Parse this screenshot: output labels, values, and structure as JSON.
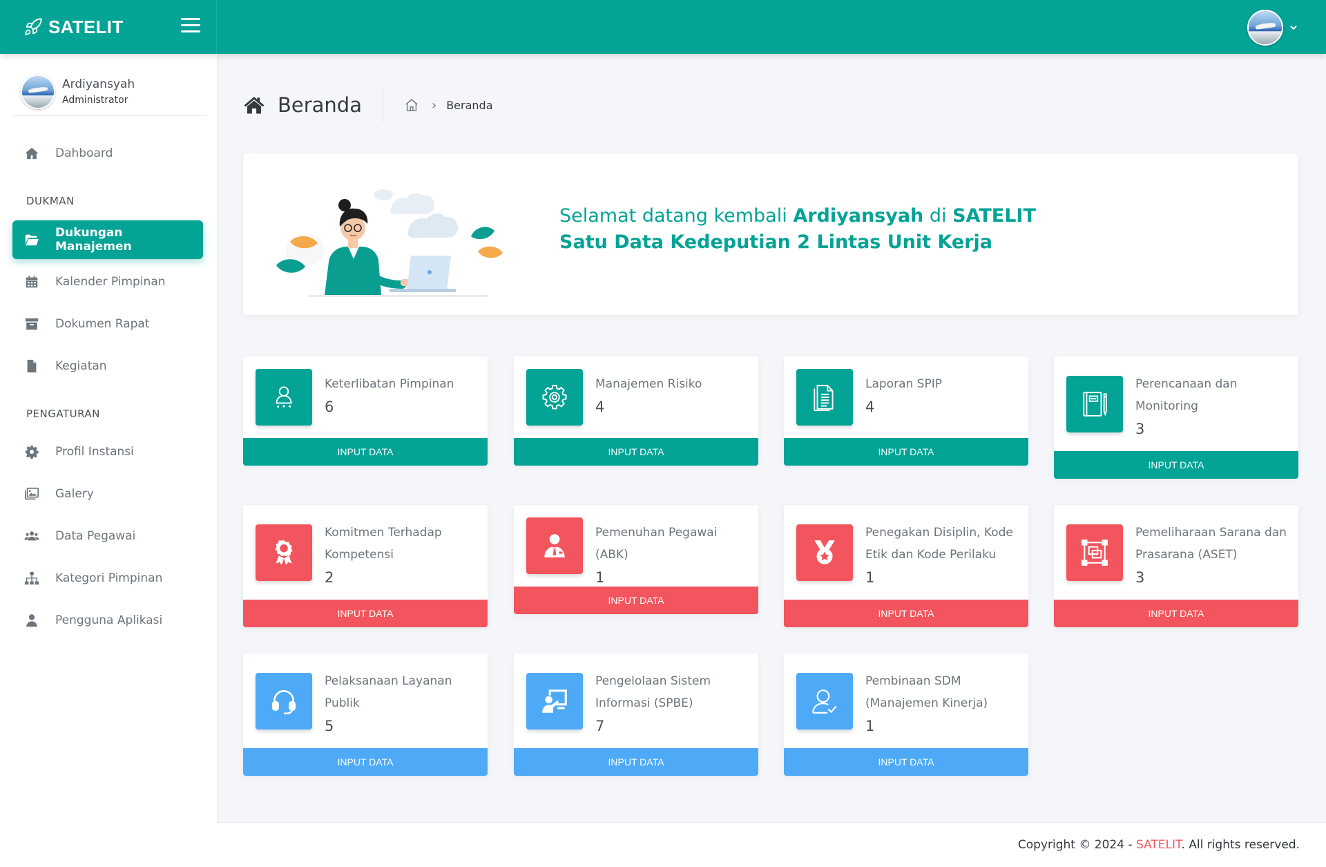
{
  "app": {
    "brand": "SATELIT"
  },
  "user": {
    "name": "Ardiyansyah",
    "role": "Administrator"
  },
  "sidebar": {
    "dashboard": "Dahboard",
    "section_dukman": "DUKMAN",
    "section_pengaturan": "PENGATURAN",
    "items": [
      {
        "label": "Dukungan Manajemen",
        "icon": "folder-open-icon",
        "active": true
      },
      {
        "label": "Kalender Pimpinan",
        "icon": "calendar-icon"
      },
      {
        "label": "Dokumen Rapat",
        "icon": "archive-icon"
      },
      {
        "label": "Kegiatan",
        "icon": "file-icon"
      },
      {
        "label": "Profil Instansi",
        "icon": "gear-icon"
      },
      {
        "label": "Galery",
        "icon": "images-icon"
      },
      {
        "label": "Data Pegawai",
        "icon": "users-icon"
      },
      {
        "label": "Kategori Pimpinan",
        "icon": "sitemap-icon"
      },
      {
        "label": "Pengguna Aplikasi",
        "icon": "user-icon"
      }
    ]
  },
  "page": {
    "title": "Beranda",
    "breadcrumb_current": "Beranda"
  },
  "welcome": {
    "line1_prefix": "Selamat datang kembali ",
    "line1_name": "Ardiyansyah",
    "line1_mid": " di ",
    "line1_brand": "SATELIT",
    "line2": "Satu Data Kedeputian 2 Lintas Unit Kerja"
  },
  "colors": {
    "teal": "#03a396",
    "red": "#f2555d",
    "blue": "#4eaaf6"
  },
  "cards": [
    {
      "label": "Keterlibatan Pimpinan",
      "count": "6",
      "button": "INPUT DATA",
      "color": "teal",
      "icon": "leader-icon"
    },
    {
      "label": "Manajemen Risiko",
      "count": "4",
      "button": "INPUT DATA",
      "color": "teal",
      "icon": "gear-icon"
    },
    {
      "label": "Laporan SPIP",
      "count": "4",
      "button": "INPUT DATA",
      "color": "teal",
      "icon": "document-icon"
    },
    {
      "label": "Perencanaan dan Monitoring",
      "count": "3",
      "button": "INPUT DATA",
      "color": "teal",
      "icon": "notebook-icon"
    },
    {
      "label": "Komitmen Terhadap Kompetensi",
      "count": "2",
      "button": "INPUT DATA",
      "color": "red",
      "icon": "award-icon"
    },
    {
      "label": "Pemenuhan Pegawai (ABK)",
      "count": "1",
      "button": "INPUT DATA",
      "color": "red",
      "icon": "employee-icon"
    },
    {
      "label": "Penegakan Disiplin, Kode Etik dan Kode Perilaku",
      "count": "1",
      "button": "INPUT DATA",
      "color": "red",
      "icon": "medal-icon"
    },
    {
      "label": "Pemeliharaan Sarana dan Prasarana (ASET)",
      "count": "3",
      "button": "INPUT DATA",
      "color": "red",
      "icon": "asset-icon"
    },
    {
      "label": "Pelaksanaan Layanan Publik",
      "count": "5",
      "button": "INPUT DATA",
      "color": "blue",
      "icon": "headset-icon"
    },
    {
      "label": "Pengelolaan Sistem Informasi (SPBE)",
      "count": "7",
      "button": "INPUT DATA",
      "color": "blue",
      "icon": "presentation-icon"
    },
    {
      "label": "Pembinaan SDM (Manajemen Kinerja)",
      "count": "1",
      "button": "INPUT DATA",
      "color": "blue",
      "icon": "user-check-icon"
    }
  ],
  "footer": {
    "prefix": "Copyright © 2024 - ",
    "brand": "SATELIT",
    "suffix": ". All rights reserved."
  }
}
